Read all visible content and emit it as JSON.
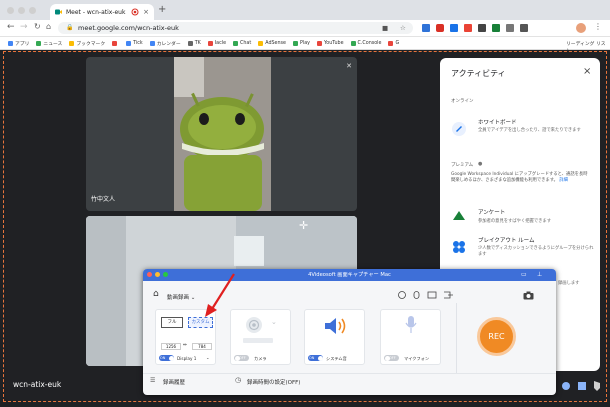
{
  "browser": {
    "tab_title": "Meet - wcn-atix-euk",
    "new_tab": "+",
    "url": "meet.google.com/wcn-atix-euk",
    "bookmarks": [
      {
        "label": "アプリ",
        "color": "#4285f4"
      },
      {
        "label": "ニュース",
        "color": "#34a853"
      },
      {
        "label": "ブックマーク",
        "color": "#fbbc04"
      },
      {
        "label": "",
        "color": "#e8453c"
      },
      {
        "label": "Tick",
        "color": "#4285f4"
      },
      {
        "label": "カレンダー",
        "color": "#4285f4"
      },
      {
        "label": "TK",
        "color": "#666666"
      },
      {
        "label": "Iacle",
        "color": "#e8453c"
      },
      {
        "label": "Chat",
        "color": "#34a853"
      },
      {
        "label": "AdSense",
        "color": "#fbbc04"
      },
      {
        "label": "Play",
        "color": "#34a853"
      },
      {
        "label": "YouTube",
        "color": "#e8453c"
      },
      {
        "label": "C.Console",
        "color": "#34a853"
      },
      {
        "label": "G",
        "color": "#e8453c"
      }
    ],
    "reading_list": "リーディング リスト"
  },
  "meet": {
    "tile1_name": "竹中文人",
    "meeting_code": "wcn-atix-euk"
  },
  "activity": {
    "title": "アクティビティ",
    "section_online": "オンライン",
    "whiteboard_title": "ホワイトボード",
    "whiteboard_desc": "全員でアイデアを出し合ったり、話で来たりできます",
    "section_premium": "プレミアム",
    "premium_desc": "Google Workspace Individual にアップグレードすると、通話を長時間楽しめるほか、さまざまな追加機能も利用できます。",
    "premium_link": "詳細",
    "survey_title": "アンケート",
    "survey_desc": "参加者の意見をすばやく把握できます",
    "breakout_title": "ブレイクアウト ルーム",
    "breakout_desc": "少人数でディスカッションできるようにグループを分けられます",
    "partial_desc": "録画します"
  },
  "recorder": {
    "title": "4Videosoft 画面キャプチャー Mac",
    "mode_label": "動画録画",
    "full_label": "フル",
    "custom_label": "カスタム",
    "width": "1256",
    "height": "784",
    "link_symbol": "⇔",
    "display_label": "Display 1",
    "camera_label": "カメラ",
    "system_audio_label": "システム音",
    "mic_label": "マイクフォン",
    "on_label": "ON",
    "off_label": "OFF",
    "rec_label": "REC",
    "history_label": "録画履歴",
    "schedule_label": "録画時間の設定(OFF)"
  },
  "colors": {
    "accent": "#3e6fd8",
    "rec": "#f08a24",
    "toggle_on": "#3e6fd8",
    "toggle_off": "#c8ccd2",
    "arrow": "#e02020"
  }
}
